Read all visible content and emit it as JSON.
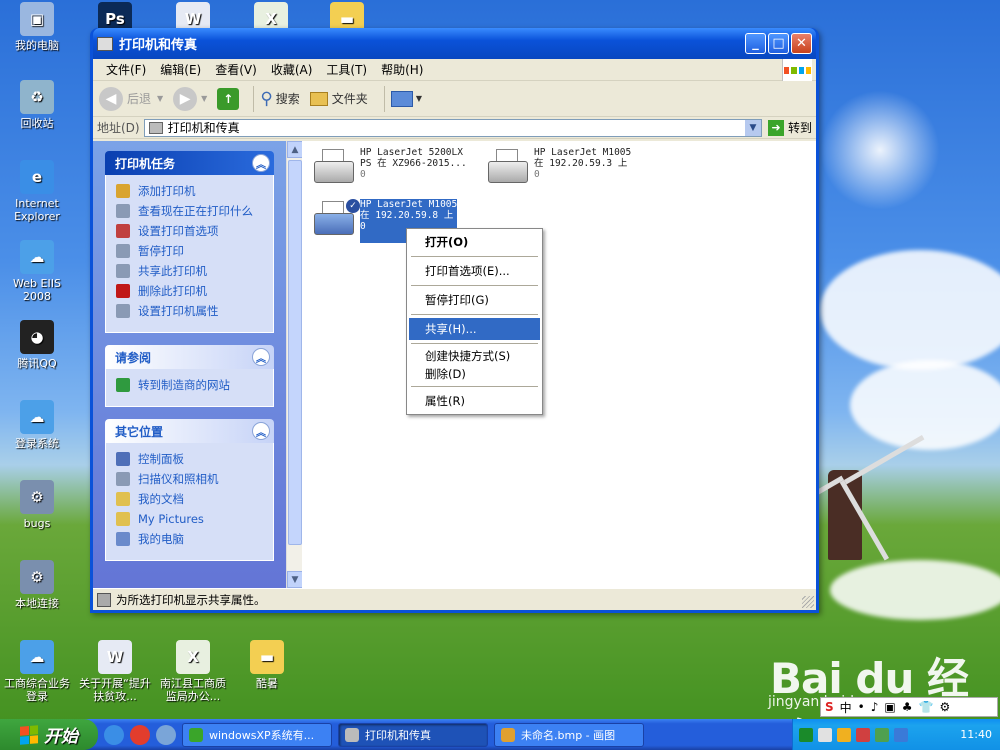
{
  "desktop": {
    "icons": [
      {
        "label": "我的电脑",
        "glyph": "▣",
        "color": "#9ab7e0"
      },
      {
        "label": "",
        "glyph": "Ps",
        "color": "#0b2a57"
      },
      {
        "label": "",
        "glyph": "W",
        "color": "#e6eaf4"
      },
      {
        "label": "",
        "glyph": "X",
        "color": "#e8f0e0"
      },
      {
        "label": "",
        "glyph": "▬",
        "color": "#f3cf52"
      },
      {
        "label": "回收站",
        "glyph": "♻",
        "color": "#8fb4cc"
      },
      {
        "label": "Internet Explorer",
        "glyph": "e",
        "color": "#3a8ee6"
      },
      {
        "label": "Web EIIS 2008",
        "glyph": "☁",
        "color": "#4ca0e8"
      },
      {
        "label": "腾讯QQ",
        "glyph": "◕",
        "color": "#222"
      },
      {
        "label": "登录系统",
        "glyph": "☁",
        "color": "#4ca0e8"
      },
      {
        "label": "bugs",
        "glyph": "⚙",
        "color": "#7a8fae"
      },
      {
        "label": "本地连接",
        "glyph": "⚙",
        "color": "#7a8fae"
      },
      {
        "label": "工商综合业务登录",
        "glyph": "☁",
        "color": "#4ca0e8"
      },
      {
        "label": "关于开展“提升扶贫攻...",
        "glyph": "W",
        "color": "#e6eaf4"
      },
      {
        "label": "南江县工商质监局办公...",
        "glyph": "X",
        "color": "#e8f0e0"
      },
      {
        "label": "酷暑",
        "glyph": "▬",
        "color": "#f3cf52"
      }
    ]
  },
  "window": {
    "title": "打印机和传真",
    "menu": [
      "文件(F)",
      "编辑(E)",
      "查看(V)",
      "收藏(A)",
      "工具(T)",
      "帮助(H)"
    ],
    "toolbar": {
      "back": "后退",
      "search": "搜索",
      "folders": "文件夹"
    },
    "address": {
      "label": "地址(D)",
      "value": "打印机和传真",
      "go": "转到"
    },
    "panels": [
      {
        "title": "打印机任务",
        "items": [
          {
            "label": "添加打印机",
            "icon_color": "#d9a430"
          },
          {
            "label": "查看现在正在打印什么",
            "icon_color": "#8a9ab5"
          },
          {
            "label": "设置打印首选项",
            "icon_color": "#c04040"
          },
          {
            "label": "暂停打印",
            "icon_color": "#8a9ab5"
          },
          {
            "label": "共享此打印机",
            "icon_color": "#8a9ab5"
          },
          {
            "label": "删除此打印机",
            "icon_color": "#c01818"
          },
          {
            "label": "设置打印机属性",
            "icon_color": "#8a9ab5"
          }
        ]
      },
      {
        "title": "请参阅",
        "items": [
          {
            "label": "转到制造商的网站",
            "icon_color": "#2f9a3f"
          }
        ]
      },
      {
        "title": "其它位置",
        "items": [
          {
            "label": "控制面板",
            "icon_color": "#4f6fb8"
          },
          {
            "label": "扫描仪和照相机",
            "icon_color": "#8a9ab5"
          },
          {
            "label": "我的文档",
            "icon_color": "#e0c050"
          },
          {
            "label": "My Pictures",
            "icon_color": "#e0c050"
          },
          {
            "label": "我的电脑",
            "icon_color": "#6a8acb"
          }
        ]
      }
    ],
    "printers": [
      {
        "line1": "HP LaserJet 5200LX",
        "line2": "PS 在 XZ966-2015...",
        "line3": "0"
      },
      {
        "line1": "HP LaserJet M1005",
        "line2": "在 192.20.59.3 上",
        "line3": "0"
      },
      {
        "line1": "HP LaserJet M1005",
        "line2": "在 192.20.59.8 上",
        "line3": "0"
      }
    ],
    "context_menu": {
      "open": "打开(O)",
      "prefs": "打印首选项(E)...",
      "pause": "暂停打印(G)",
      "share": "共享(H)...",
      "shortcut": "创建快捷方式(S)",
      "delete": "删除(D)",
      "properties": "属性(R)"
    },
    "status": "为所选打印机显示共享属性。"
  },
  "taskbar": {
    "start": "开始",
    "tasks": [
      {
        "label": "windowsXP系统有...",
        "icon_color": "#3aa52a"
      },
      {
        "label": "打印机和传真",
        "icon_color": "#bbb"
      },
      {
        "label": "未命名.bmp - 画图",
        "icon_color": "#e0a030"
      }
    ],
    "clock": "11:40"
  },
  "ime": {
    "items": [
      "S",
      "中",
      "•",
      "♪",
      "▣",
      "♣",
      "👕",
      "⚙"
    ]
  },
  "watermark": {
    "logo": "Bai du 经验",
    "url": "jingyan.baidu.com"
  }
}
